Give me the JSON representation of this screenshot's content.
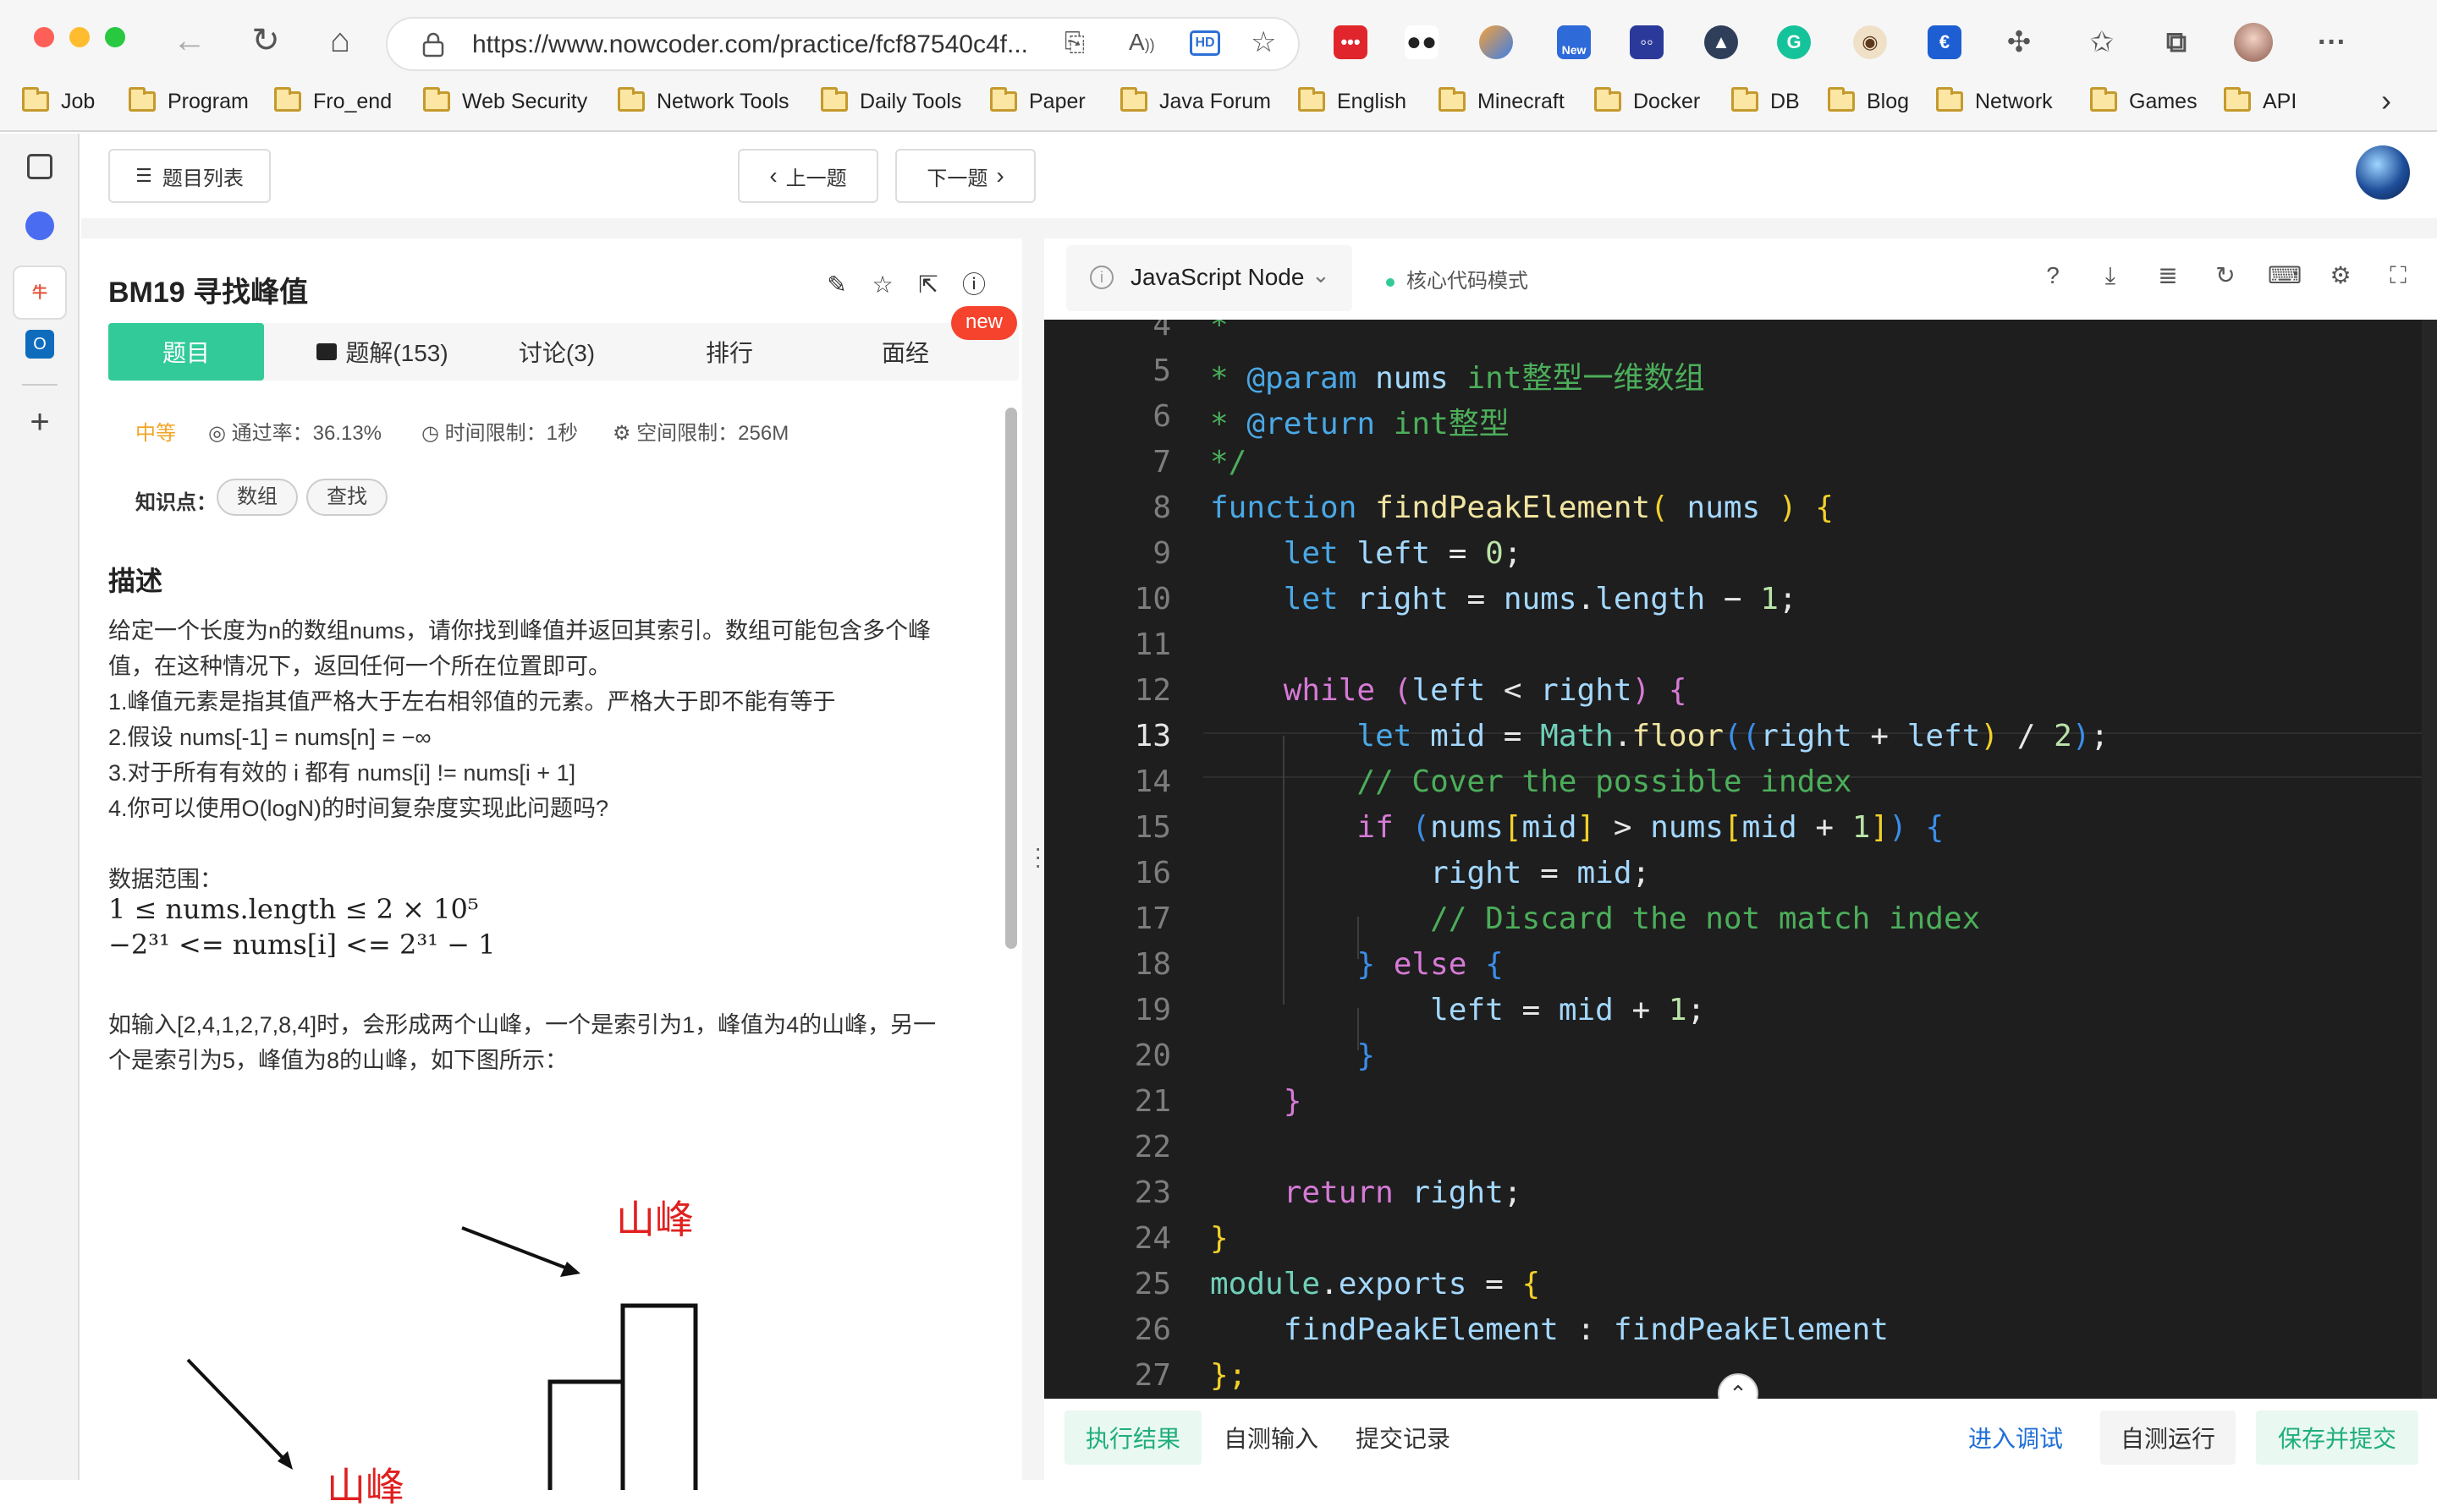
{
  "browser": {
    "url": "https://www.nowcoder.com/practice/fcf87540c4f...",
    "new_badge": "New",
    "bookmarks": [
      "Job",
      "Program",
      "Fro_end",
      "Web Security",
      "Network Tools",
      "Daily Tools",
      "Paper",
      "Java Forum",
      "English",
      "Minecraft",
      "Docker",
      "DB",
      "Blog",
      "Network",
      "Games",
      "API"
    ]
  },
  "appbar": {
    "list_label": "题目列表",
    "prev_label": "上一题",
    "next_label": "下一题"
  },
  "problem": {
    "title": "BM19  寻找峰值",
    "tabs": [
      "题目",
      "题解(153)",
      "讨论(3)",
      "排行",
      "面经"
    ],
    "new_badge": "new",
    "difficulty": "中等",
    "pass_rate": "通过率：36.13%",
    "time_limit": "时间限制：1秒",
    "space_limit": "空间限制：256M",
    "knowledge_label": "知识点：",
    "tags": [
      "数组",
      "查找"
    ],
    "desc_heading": "描述",
    "desc_lines": [
      "给定一个长度为n的数组nums，请你找到峰值并返回其索引。数组可能包含多个峰",
      "值，在这种情况下，返回任何一个所在位置即可。",
      "1.峰值元素是指其值严格大于左右相邻值的元素。严格大于即不能有等于",
      "2.假设 nums[-1] = nums[n] = −∞",
      "3.对于所有有效的 i 都有 nums[i] != nums[i + 1]",
      "4.你可以使用O(logN)的时间复杂度实现此问题吗?"
    ],
    "range_label": "数据范围：",
    "range_line1": "1 ≤ nums.length ≤ 2 × 10⁵",
    "range_line2": "−2³¹ <= nums[i] <= 2³¹ − 1",
    "example_lines": [
      "如输入[2,4,1,2,7,8,4]时，会形成两个山峰，一个是索引为1，峰值为4的山峰，另一",
      "个是索引为5，峰值为8的山峰，如下图所示："
    ],
    "figure_label": "山峰"
  },
  "editor": {
    "language": "JavaScript Node",
    "mode": "核心代码模式",
    "lines": [
      {
        "n": "4"
      },
      {
        "n": "5"
      },
      {
        "n": "6"
      },
      {
        "n": "7"
      },
      {
        "n": "8"
      },
      {
        "n": "9"
      },
      {
        "n": "10"
      },
      {
        "n": "11"
      },
      {
        "n": "12"
      },
      {
        "n": "13"
      },
      {
        "n": "14"
      },
      {
        "n": "15"
      },
      {
        "n": "16"
      },
      {
        "n": "17"
      },
      {
        "n": "18"
      },
      {
        "n": "19"
      },
      {
        "n": "20"
      },
      {
        "n": "21"
      },
      {
        "n": "22"
      },
      {
        "n": "23"
      },
      {
        "n": "24"
      },
      {
        "n": "25"
      },
      {
        "n": "26"
      },
      {
        "n": "27"
      }
    ],
    "current_line": "13",
    "code": {
      "l4": "*",
      "l5_star": "* ",
      "l5_tag": "@param",
      "l5_name": " nums",
      "l5_rest": " int整型一维数组",
      "l6_star": "* ",
      "l6_tag": "@return",
      "l6_rest": " int整型",
      "l7": "*/",
      "l8_kw": "function",
      "l8_fn": " findPeakElement",
      "l8_p1": "(",
      "l8_arg": " nums ",
      "l8_p2": ")",
      "l8_br": " {",
      "l9_kw": "let",
      "l9_var": " left",
      "l9_op": " = ",
      "l9_num": "0",
      "l9_end": ";",
      "l10_kw": "let",
      "l10_var": " right",
      "l10_op": " = ",
      "l10_obj": "nums",
      "l10_dot": ".",
      "l10_prop": "length",
      "l10_op2": " − ",
      "l10_num": "1",
      "l10_end": ";",
      "l12_kw": "while",
      "l12_p1": " (",
      "l12_a": "left",
      "l12_op": " < ",
      "l12_b": "right",
      "l12_p2": ")",
      "l12_br": " {",
      "l13_kw": "let",
      "l13_var": " mid",
      "l13_op": " = ",
      "l13_obj": "Math",
      "l13_dot": ".",
      "l13_fn": "floor",
      "l13_p1": "((",
      "l13_a": "right",
      "l13_op2": " + ",
      "l13_b": "left",
      "l13_p2": ")",
      "l13_op3": " / ",
      "l13_num": "2",
      "l13_p3": ")",
      "l13_end": ";",
      "l14": "// Cover the possible index",
      "l15_kw": "if",
      "l15_p1": " (",
      "l15_a": "nums",
      "l15_b1": "[",
      "l15_i": "mid",
      "l15_b2": "]",
      "l15_op": " > ",
      "l15_c": "nums",
      "l15_b3": "[",
      "l15_j": "mid",
      "l15_op2": " + ",
      "l15_num": "1",
      "l15_b4": "]",
      "l15_p2": ")",
      "l15_br": " {",
      "l16_var": "right",
      "l16_op": " = ",
      "l16_val": "mid",
      "l16_end": ";",
      "l17": "// Discard the not match index",
      "l18_br": "}",
      "l18_kw": " else",
      "l18_br2": " {",
      "l19_var": "left",
      "l19_op": " = ",
      "l19_val": "mid",
      "l19_op2": " + ",
      "l19_num": "1",
      "l19_end": ";",
      "l20": "}",
      "l21": "}",
      "l23_kw": "return",
      "l23_var": " right",
      "l23_end": ";",
      "l24": "}",
      "l25_a": "module",
      "l25_dot": ".",
      "l25_b": "exports",
      "l25_op": " = ",
      "l25_br": "{",
      "l26_a": "findPeakElement",
      "l26_op": " : ",
      "l26_b": "findPeakElement",
      "l27": "};"
    }
  },
  "bottom": {
    "result_tab": "执行结果",
    "custom_input_tab": "自测输入",
    "history_tab": "提交记录",
    "debug": "进入调试",
    "run": "自测运行",
    "submit": "保存并提交"
  }
}
